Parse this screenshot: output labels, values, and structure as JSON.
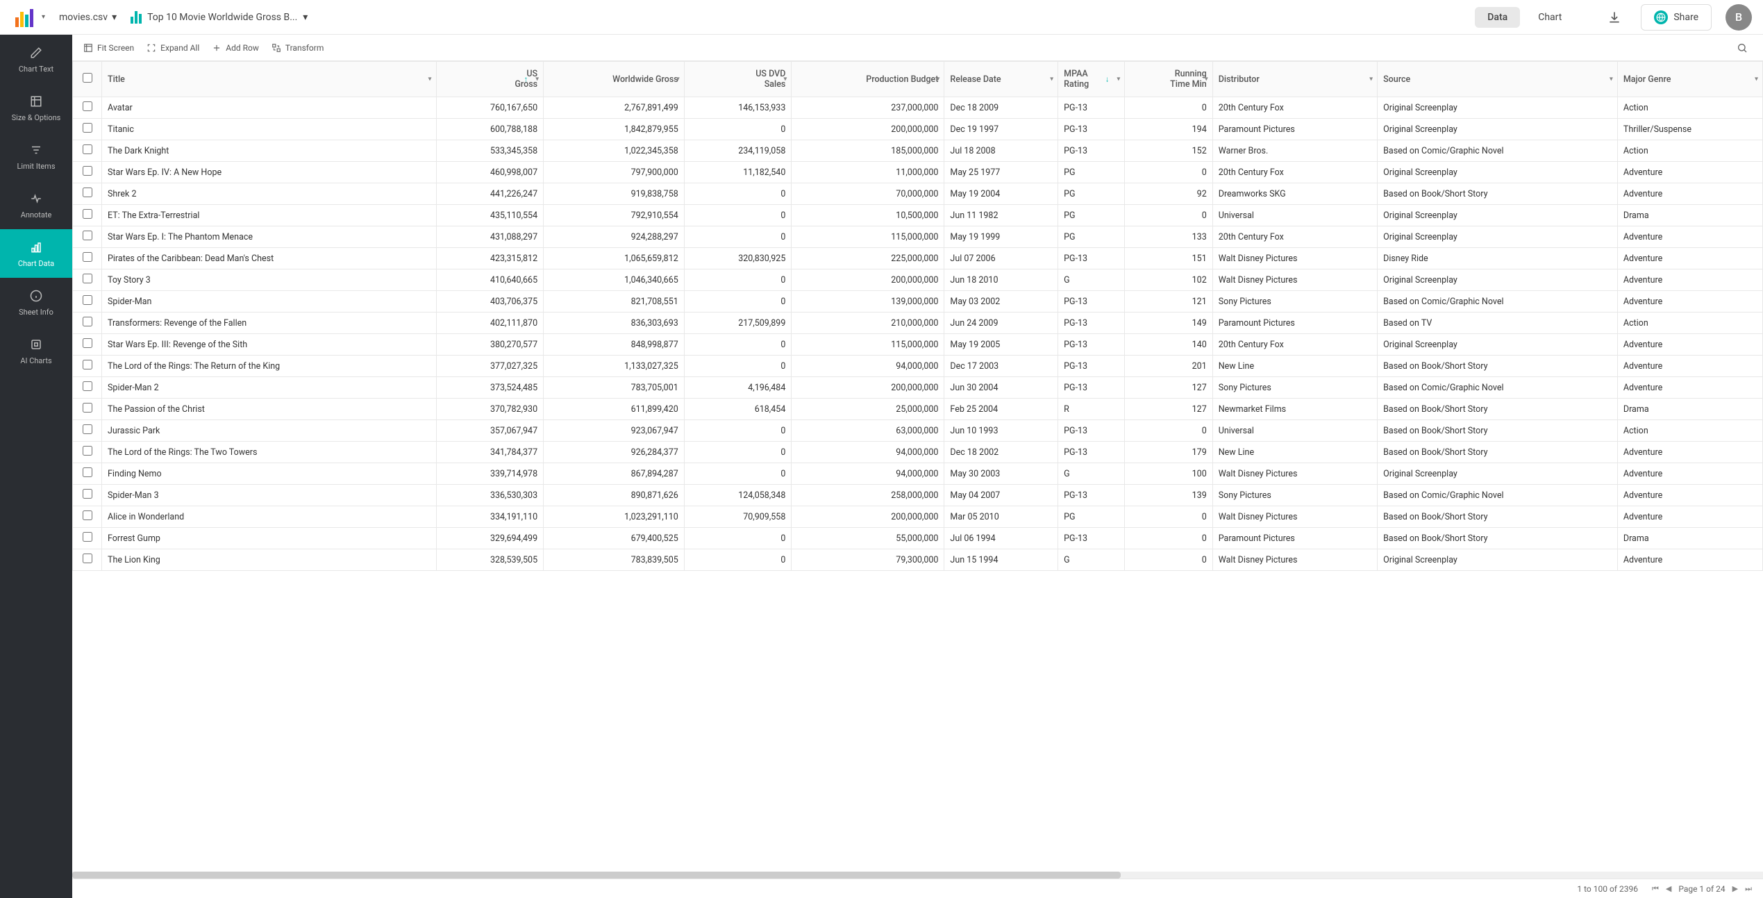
{
  "header": {
    "file_name": "movies.csv",
    "chart_title": "Top 10 Movie Worldwide Gross B...",
    "tabs": {
      "data": "Data",
      "chart": "Chart"
    },
    "share_label": "Share",
    "avatar_letter": "B"
  },
  "sidebar": {
    "items": [
      {
        "label": "Chart Text"
      },
      {
        "label": "Size & Options"
      },
      {
        "label": "Limit Items"
      },
      {
        "label": "Annotate"
      },
      {
        "label": "Chart Data"
      },
      {
        "label": "Sheet Info"
      },
      {
        "label": "AI Charts"
      }
    ]
  },
  "toolbar": {
    "fit_screen": "Fit Screen",
    "expand_all": "Expand All",
    "add_row": "Add Row",
    "transform": "Transform"
  },
  "columns": [
    {
      "label": "Title",
      "align": "left"
    },
    {
      "label": "US\nGross",
      "align": "right",
      "sort": "asc"
    },
    {
      "label": "Worldwide Gross",
      "align": "right"
    },
    {
      "label": "US DVD\nSales",
      "align": "right"
    },
    {
      "label": "Production Budget",
      "align": "right"
    },
    {
      "label": "Release Date",
      "align": "left"
    },
    {
      "label": "MPAA\nRating",
      "align": "left",
      "sort": "desc"
    },
    {
      "label": "Running\nTime Min",
      "align": "right"
    },
    {
      "label": "Distributor",
      "align": "left"
    },
    {
      "label": "Source",
      "align": "left"
    },
    {
      "label": "Major Genre",
      "align": "left"
    }
  ],
  "rows": [
    [
      "Avatar",
      "760,167,650",
      "2,767,891,499",
      "146,153,933",
      "237,000,000",
      "Dec 18 2009",
      "PG-13",
      "0",
      "20th Century Fox",
      "Original Screenplay",
      "Action"
    ],
    [
      "Titanic",
      "600,788,188",
      "1,842,879,955",
      "0",
      "200,000,000",
      "Dec 19 1997",
      "PG-13",
      "194",
      "Paramount Pictures",
      "Original Screenplay",
      "Thriller/Suspense"
    ],
    [
      "The Dark Knight",
      "533,345,358",
      "1,022,345,358",
      "234,119,058",
      "185,000,000",
      "Jul 18 2008",
      "PG-13",
      "152",
      "Warner Bros.",
      "Based on Comic/Graphic Novel",
      "Action"
    ],
    [
      "Star Wars Ep. IV: A New Hope",
      "460,998,007",
      "797,900,000",
      "11,182,540",
      "11,000,000",
      "May 25 1977",
      "PG",
      "0",
      "20th Century Fox",
      "Original Screenplay",
      "Adventure"
    ],
    [
      "Shrek 2",
      "441,226,247",
      "919,838,758",
      "0",
      "70,000,000",
      "May 19 2004",
      "PG",
      "92",
      "Dreamworks SKG",
      "Based on Book/Short Story",
      "Adventure"
    ],
    [
      "ET: The Extra-Terrestrial",
      "435,110,554",
      "792,910,554",
      "0",
      "10,500,000",
      "Jun 11 1982",
      "PG",
      "0",
      "Universal",
      "Original Screenplay",
      "Drama"
    ],
    [
      "Star Wars Ep. I: The Phantom Menace",
      "431,088,297",
      "924,288,297",
      "0",
      "115,000,000",
      "May 19 1999",
      "PG",
      "133",
      "20th Century Fox",
      "Original Screenplay",
      "Adventure"
    ],
    [
      "Pirates of the Caribbean: Dead Man's Chest",
      "423,315,812",
      "1,065,659,812",
      "320,830,925",
      "225,000,000",
      "Jul 07 2006",
      "PG-13",
      "151",
      "Walt Disney Pictures",
      "Disney Ride",
      "Adventure"
    ],
    [
      "Toy Story 3",
      "410,640,665",
      "1,046,340,665",
      "0",
      "200,000,000",
      "Jun 18 2010",
      "G",
      "102",
      "Walt Disney Pictures",
      "Original Screenplay",
      "Adventure"
    ],
    [
      "Spider-Man",
      "403,706,375",
      "821,708,551",
      "0",
      "139,000,000",
      "May 03 2002",
      "PG-13",
      "121",
      "Sony Pictures",
      "Based on Comic/Graphic Novel",
      "Adventure"
    ],
    [
      "Transformers: Revenge of the Fallen",
      "402,111,870",
      "836,303,693",
      "217,509,899",
      "210,000,000",
      "Jun 24 2009",
      "PG-13",
      "149",
      "Paramount Pictures",
      "Based on TV",
      "Action"
    ],
    [
      "Star Wars Ep. III: Revenge of the Sith",
      "380,270,577",
      "848,998,877",
      "0",
      "115,000,000",
      "May 19 2005",
      "PG-13",
      "140",
      "20th Century Fox",
      "Original Screenplay",
      "Adventure"
    ],
    [
      "The Lord of the Rings: The Return of the King",
      "377,027,325",
      "1,133,027,325",
      "0",
      "94,000,000",
      "Dec 17 2003",
      "PG-13",
      "201",
      "New Line",
      "Based on Book/Short Story",
      "Adventure"
    ],
    [
      "Spider-Man 2",
      "373,524,485",
      "783,705,001",
      "4,196,484",
      "200,000,000",
      "Jun 30 2004",
      "PG-13",
      "127",
      "Sony Pictures",
      "Based on Comic/Graphic Novel",
      "Adventure"
    ],
    [
      "The Passion of the Christ",
      "370,782,930",
      "611,899,420",
      "618,454",
      "25,000,000",
      "Feb 25 2004",
      "R",
      "127",
      "Newmarket Films",
      "Based on Book/Short Story",
      "Drama"
    ],
    [
      "Jurassic Park",
      "357,067,947",
      "923,067,947",
      "0",
      "63,000,000",
      "Jun 10 1993",
      "PG-13",
      "0",
      "Universal",
      "Based on Book/Short Story",
      "Action"
    ],
    [
      "The Lord of the Rings: The Two Towers",
      "341,784,377",
      "926,284,377",
      "0",
      "94,000,000",
      "Dec 18 2002",
      "PG-13",
      "179",
      "New Line",
      "Based on Book/Short Story",
      "Adventure"
    ],
    [
      "Finding Nemo",
      "339,714,978",
      "867,894,287",
      "0",
      "94,000,000",
      "May 30 2003",
      "G",
      "100",
      "Walt Disney Pictures",
      "Original Screenplay",
      "Adventure"
    ],
    [
      "Spider-Man 3",
      "336,530,303",
      "890,871,626",
      "124,058,348",
      "258,000,000",
      "May 04 2007",
      "PG-13",
      "139",
      "Sony Pictures",
      "Based on Comic/Graphic Novel",
      "Adventure"
    ],
    [
      "Alice in Wonderland",
      "334,191,110",
      "1,023,291,110",
      "70,909,558",
      "200,000,000",
      "Mar 05 2010",
      "PG",
      "0",
      "Walt Disney Pictures",
      "Based on Book/Short Story",
      "Adventure"
    ],
    [
      "Forrest Gump",
      "329,694,499",
      "679,400,525",
      "0",
      "55,000,000",
      "Jul 06 1994",
      "PG-13",
      "0",
      "Paramount Pictures",
      "Based on Book/Short Story",
      "Drama"
    ],
    [
      "The Lion King",
      "328,539,505",
      "783,839,505",
      "0",
      "79,300,000",
      "Jun 15 1994",
      "G",
      "0",
      "Walt Disney Pictures",
      "Original Screenplay",
      "Adventure"
    ]
  ],
  "status": {
    "range": "1 to 100 of 2396",
    "page": "Page 1 of 24"
  }
}
